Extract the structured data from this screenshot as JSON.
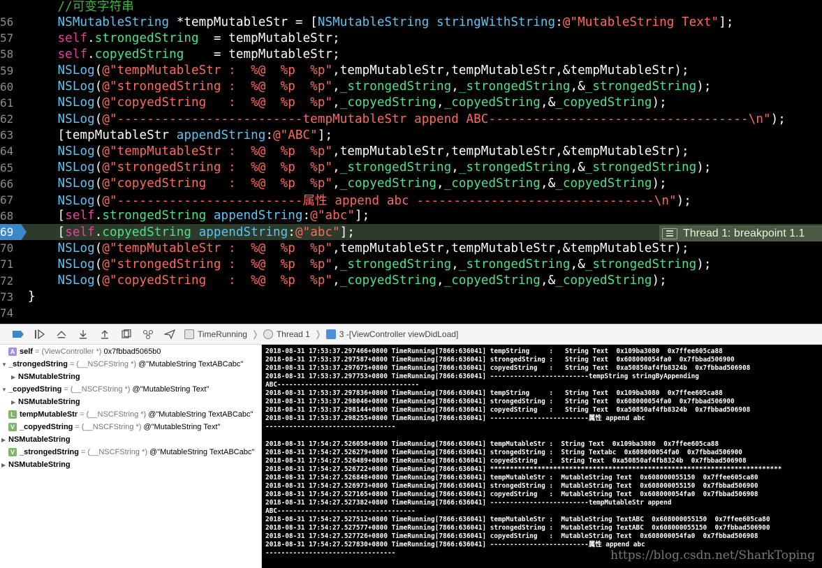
{
  "editor": {
    "lines": [
      {
        "num": "",
        "tokens": [
          {
            "c": "t-plain",
            "t": "    "
          },
          {
            "c": "t-comment",
            "t": "//可变字符串"
          }
        ]
      },
      {
        "num": "56",
        "tokens": [
          {
            "c": "t-plain",
            "t": "    "
          },
          {
            "c": "t-class",
            "t": "NSMutableString"
          },
          {
            "c": "t-plain",
            "t": " *tempMutableStr = ["
          },
          {
            "c": "t-class",
            "t": "NSMutableString"
          },
          {
            "c": "t-plain",
            "t": " "
          },
          {
            "c": "t-method",
            "t": "stringWithString"
          },
          {
            "c": "t-plain",
            "t": ":"
          },
          {
            "c": "t-str",
            "t": "@\"MutableString Text\""
          },
          {
            "c": "t-plain",
            "t": "];"
          }
        ]
      },
      {
        "num": "57",
        "tokens": [
          {
            "c": "t-plain",
            "t": "    "
          },
          {
            "c": "t-kw",
            "t": "self"
          },
          {
            "c": "t-plain",
            "t": "."
          },
          {
            "c": "t-prop",
            "t": "strongedString"
          },
          {
            "c": "t-plain",
            "t": "  = tempMutableStr;"
          }
        ]
      },
      {
        "num": "58",
        "tokens": [
          {
            "c": "t-plain",
            "t": "    "
          },
          {
            "c": "t-kw",
            "t": "self"
          },
          {
            "c": "t-plain",
            "t": "."
          },
          {
            "c": "t-prop",
            "t": "copyedString"
          },
          {
            "c": "t-plain",
            "t": "    = tempMutableStr;"
          }
        ]
      },
      {
        "num": "59",
        "tokens": [
          {
            "c": "t-plain",
            "t": "    "
          },
          {
            "c": "t-class",
            "t": "NSLog"
          },
          {
            "c": "t-plain",
            "t": "("
          },
          {
            "c": "t-str",
            "t": "@\"tempMutableStr :  %@  %p  %p\""
          },
          {
            "c": "t-plain",
            "t": ",tempMutableStr,tempMutableStr,&tempMutableStr);"
          }
        ]
      },
      {
        "num": "60",
        "tokens": [
          {
            "c": "t-plain",
            "t": "    "
          },
          {
            "c": "t-class",
            "t": "NSLog"
          },
          {
            "c": "t-plain",
            "t": "("
          },
          {
            "c": "t-str",
            "t": "@\"strongedString :  %@  %p  %p\""
          },
          {
            "c": "t-plain",
            "t": ","
          },
          {
            "c": "t-prop",
            "t": "_strongedString"
          },
          {
            "c": "t-plain",
            "t": ","
          },
          {
            "c": "t-prop",
            "t": "_strongedString"
          },
          {
            "c": "t-plain",
            "t": ",&"
          },
          {
            "c": "t-prop",
            "t": "_strongedString"
          },
          {
            "c": "t-plain",
            "t": ");"
          }
        ]
      },
      {
        "num": "61",
        "tokens": [
          {
            "c": "t-plain",
            "t": "    "
          },
          {
            "c": "t-class",
            "t": "NSLog"
          },
          {
            "c": "t-plain",
            "t": "("
          },
          {
            "c": "t-str",
            "t": "@\"copyedString   :  %@  %p  %p\""
          },
          {
            "c": "t-plain",
            "t": ","
          },
          {
            "c": "t-prop",
            "t": "_copyedString"
          },
          {
            "c": "t-plain",
            "t": ","
          },
          {
            "c": "t-prop",
            "t": "_copyedString"
          },
          {
            "c": "t-plain",
            "t": ",&"
          },
          {
            "c": "t-prop",
            "t": "_copyedString"
          },
          {
            "c": "t-plain",
            "t": ");"
          }
        ]
      },
      {
        "num": "62",
        "tokens": [
          {
            "c": "t-plain",
            "t": "    "
          },
          {
            "c": "t-class",
            "t": "NSLog"
          },
          {
            "c": "t-plain",
            "t": "("
          },
          {
            "c": "t-str",
            "t": "@\"-------------------------tempMutableStr append ABC-----------------------------------\\n\""
          },
          {
            "c": "t-plain",
            "t": ");"
          }
        ]
      },
      {
        "num": "63",
        "tokens": [
          {
            "c": "t-plain",
            "t": "    [tempMutableStr "
          },
          {
            "c": "t-method",
            "t": "appendString"
          },
          {
            "c": "t-plain",
            "t": ":"
          },
          {
            "c": "t-str",
            "t": "@\"ABC\""
          },
          {
            "c": "t-plain",
            "t": "];"
          }
        ]
      },
      {
        "num": "64",
        "tokens": [
          {
            "c": "t-plain",
            "t": "    "
          },
          {
            "c": "t-class",
            "t": "NSLog"
          },
          {
            "c": "t-plain",
            "t": "("
          },
          {
            "c": "t-str",
            "t": "@\"tempMutableStr :  %@  %p  %p\""
          },
          {
            "c": "t-plain",
            "t": ",tempMutableStr,tempMutableStr,&tempMutableStr);"
          }
        ]
      },
      {
        "num": "65",
        "tokens": [
          {
            "c": "t-plain",
            "t": "    "
          },
          {
            "c": "t-class",
            "t": "NSLog"
          },
          {
            "c": "t-plain",
            "t": "("
          },
          {
            "c": "t-str",
            "t": "@\"strongedString :  %@  %p  %p\""
          },
          {
            "c": "t-plain",
            "t": ","
          },
          {
            "c": "t-prop",
            "t": "_strongedString"
          },
          {
            "c": "t-plain",
            "t": ","
          },
          {
            "c": "t-prop",
            "t": "_strongedString"
          },
          {
            "c": "t-plain",
            "t": ",&"
          },
          {
            "c": "t-prop",
            "t": "_strongedString"
          },
          {
            "c": "t-plain",
            "t": ");"
          }
        ]
      },
      {
        "num": "66",
        "tokens": [
          {
            "c": "t-plain",
            "t": "    "
          },
          {
            "c": "t-class",
            "t": "NSLog"
          },
          {
            "c": "t-plain",
            "t": "("
          },
          {
            "c": "t-str",
            "t": "@\"copyedString   :  %@  %p  %p\""
          },
          {
            "c": "t-plain",
            "t": ","
          },
          {
            "c": "t-prop",
            "t": "_copyedString"
          },
          {
            "c": "t-plain",
            "t": ","
          },
          {
            "c": "t-prop",
            "t": "_copyedString"
          },
          {
            "c": "t-plain",
            "t": ",&"
          },
          {
            "c": "t-prop",
            "t": "_copyedString"
          },
          {
            "c": "t-plain",
            "t": ");"
          }
        ]
      },
      {
        "num": "67",
        "tokens": [
          {
            "c": "t-plain",
            "t": "    "
          },
          {
            "c": "t-class",
            "t": "NSLog"
          },
          {
            "c": "t-plain",
            "t": "("
          },
          {
            "c": "t-str",
            "t": "@\"-------------------------属性 append abc --------------------------------\\n\""
          },
          {
            "c": "t-plain",
            "t": ");"
          }
        ]
      },
      {
        "num": "68",
        "tokens": [
          {
            "c": "t-plain",
            "t": "    ["
          },
          {
            "c": "t-kw",
            "t": "self"
          },
          {
            "c": "t-plain",
            "t": "."
          },
          {
            "c": "t-prop",
            "t": "strongedString"
          },
          {
            "c": "t-plain",
            "t": " "
          },
          {
            "c": "t-method",
            "t": "appendString"
          },
          {
            "c": "t-plain",
            "t": ":"
          },
          {
            "c": "t-str",
            "t": "@\"abc\""
          },
          {
            "c": "t-plain",
            "t": "];"
          }
        ]
      },
      {
        "num": "69",
        "highlight": true,
        "tokens": [
          {
            "c": "t-plain",
            "t": "    ["
          },
          {
            "c": "t-kw",
            "t": "self"
          },
          {
            "c": "t-plain",
            "t": "."
          },
          {
            "c": "t-prop",
            "t": "copyedString"
          },
          {
            "c": "t-plain",
            "t": " "
          },
          {
            "c": "t-method",
            "t": "appendString"
          },
          {
            "c": "t-plain",
            "t": ":"
          },
          {
            "c": "t-str",
            "t": "@\"abc\""
          },
          {
            "c": "t-plain",
            "t": "];"
          }
        ]
      },
      {
        "num": "70",
        "tokens": [
          {
            "c": "t-plain",
            "t": "    "
          },
          {
            "c": "t-class",
            "t": "NSLog"
          },
          {
            "c": "t-plain",
            "t": "("
          },
          {
            "c": "t-str",
            "t": "@\"tempMutableStr :  %@  %p  %p\""
          },
          {
            "c": "t-plain",
            "t": ",tempMutableStr,tempMutableStr,&tempMutableStr);"
          }
        ]
      },
      {
        "num": "71",
        "tokens": [
          {
            "c": "t-plain",
            "t": "    "
          },
          {
            "c": "t-class",
            "t": "NSLog"
          },
          {
            "c": "t-plain",
            "t": "("
          },
          {
            "c": "t-str",
            "t": "@\"strongedString :  %@  %p  %p\""
          },
          {
            "c": "t-plain",
            "t": ","
          },
          {
            "c": "t-prop",
            "t": "_strongedString"
          },
          {
            "c": "t-plain",
            "t": ","
          },
          {
            "c": "t-prop",
            "t": "_strongedString"
          },
          {
            "c": "t-plain",
            "t": ",&"
          },
          {
            "c": "t-prop",
            "t": "_strongedString"
          },
          {
            "c": "t-plain",
            "t": ");"
          }
        ]
      },
      {
        "num": "72",
        "tokens": [
          {
            "c": "t-plain",
            "t": "    "
          },
          {
            "c": "t-class",
            "t": "NSLog"
          },
          {
            "c": "t-plain",
            "t": "("
          },
          {
            "c": "t-str",
            "t": "@\"copyedString   :  %@  %p  %p\""
          },
          {
            "c": "t-plain",
            "t": ","
          },
          {
            "c": "t-prop",
            "t": "_copyedString"
          },
          {
            "c": "t-plain",
            "t": ","
          },
          {
            "c": "t-prop",
            "t": "_copyedString"
          },
          {
            "c": "t-plain",
            "t": ",&"
          },
          {
            "c": "t-prop",
            "t": "_copyedString"
          },
          {
            "c": "t-plain",
            "t": ");"
          }
        ]
      },
      {
        "num": "73",
        "tokens": [
          {
            "c": "t-plain",
            "t": "}"
          }
        ]
      },
      {
        "num": "74",
        "tokens": []
      }
    ],
    "thread_badge": "Thread 1: breakpoint 1.1"
  },
  "debug_bar": {
    "breadcrumbs": [
      {
        "label": "TimeRunning",
        "icon": "app-icon"
      },
      {
        "label": "Thread 1",
        "icon": "thread-icon"
      },
      {
        "label": "3 -[ViewController viewDidLoad]",
        "icon": "frame-icon"
      }
    ]
  },
  "variables": [
    {
      "indent": 0,
      "disclosure": "",
      "badge": "A",
      "name": "self",
      "type": "= (ViewController *)",
      "value": "0x7fbbad5065b0"
    },
    {
      "indent": 0,
      "disclosure": "▼",
      "badge": "",
      "name": "_strongedString",
      "type": "= (__NSCFString *)",
      "value": "@\"MutableString TextABCabc\""
    },
    {
      "indent": 1,
      "disclosure": "▶",
      "badge": "",
      "name": "NSMutableString",
      "type": "",
      "value": ""
    },
    {
      "indent": 0,
      "disclosure": "▼",
      "badge": "",
      "name": "_copyedString",
      "type": "= (__NSCFString *)",
      "value": "@\"MutableString Text\""
    },
    {
      "indent": 1,
      "disclosure": "▶",
      "badge": "",
      "name": "NSMutableString",
      "type": "",
      "value": ""
    },
    {
      "indent": 0,
      "disclosure": "",
      "badge": "L",
      "name": "tempMutableStr",
      "type": "= (__NSCFString *)",
      "value": "@\"MutableString TextABCabc\""
    },
    {
      "indent": 0,
      "disclosure": "",
      "badge": "V",
      "name": "_copyedString",
      "type": "= (__NSCFString *)",
      "value": "@\"MutableString Text\""
    },
    {
      "indent": 0,
      "disclosure": "▶",
      "badge": "",
      "name": "NSMutableString",
      "type": "",
      "value": ""
    },
    {
      "indent": 0,
      "disclosure": "",
      "badge": "V",
      "name": "_strongedString",
      "type": "= (__NSCFString *)",
      "value": "@\"MutableString TextABCabc\""
    },
    {
      "indent": 0,
      "disclosure": "▶",
      "badge": "",
      "name": "NSMutableString",
      "type": "",
      "value": ""
    }
  ],
  "console": {
    "lines": [
      "2018-08-31 17:53:37.297466+0800 TimeRunning[7866:636041] tempString     :   String Text  0x109ba3080  0x7ffee605ca88",
      "2018-08-31 17:53:37.297587+0800 TimeRunning[7866:636041] strongedString :   String Text  0x608000054fa0  0x7fbbad506900",
      "2018-08-31 17:53:37.297675+0800 TimeRunning[7866:636041] copyedString   :   String Text  0xa50850af4fb8324b  0x7fbbad506908",
      "2018-08-31 17:53:37.297753+0800 TimeRunning[7866:636041] -------------------------tempString stringByAppending",
      "ABC------------------------------------",
      "2018-08-31 17:53:37.297836+0800 TimeRunning[7866:636041] tempString     :   String Text  0x109ba3080  0x7ffee605ca88",
      "2018-08-31 17:53:37.298046+0800 TimeRunning[7866:636041] strongedString :   String Text  0x608000054fa0  0x7fbbad506900",
      "2018-08-31 17:53:37.298144+0800 TimeRunning[7866:636041] copyedString   :   String Text  0xa50850af4fb8324b  0x7fbbad506908",
      "2018-08-31 17:53:37.298255+0800 TimeRunning[7866:636041] -------------------------属性 append abc",
      "---------------------------------",
      "",
      "2018-08-31 17:54:27.526058+0800 TimeRunning[7866:636041] tempMutableStr :  String Text  0x109ba3080  0x7ffee605ca88",
      "2018-08-31 17:54:27.526279+0800 TimeRunning[7866:636041] strongedString :  String Textabc  0x608000054fa0  0x7fbbad506900",
      "2018-08-31 17:54:27.526489+0800 TimeRunning[7866:636041] copyedString   :  String Text  0xa50850af4fb8324b  0x7fbbad506908",
      "2018-08-31 17:54:27.526722+0800 TimeRunning[7866:636041] **************************************************************************",
      "2018-08-31 17:54:27.526848+0800 TimeRunning[7866:636041] tempMutableStr :  MutableString Text  0x608000055150  0x7ffee605ca80",
      "2018-08-31 17:54:27.526973+0800 TimeRunning[7866:636041] strongedString :  MutableString Text  0x608000055150  0x7fbbad506900",
      "2018-08-31 17:54:27.527165+0800 TimeRunning[7866:636041] copyedString   :  MutableString Text  0x608000054fa0  0x7fbbad506908",
      "2018-08-31 17:54:27.527382+0800 TimeRunning[7866:636041] -------------------------tempMutableStr append",
      "ABC-----------------------------------",
      "2018-08-31 17:54:27.527512+0800 TimeRunning[7866:636041] tempMutableStr :  MutableString TextABC  0x608000055150  0x7ffee605ca80",
      "2018-08-31 17:54:27.527577+0800 TimeRunning[7866:636041] strongedString :  MutableString TextABC  0x608000055150  0x7fbbad506900",
      "2018-08-31 17:54:27.527726+0800 TimeRunning[7866:636041] copyedString   :  MutableString Text  0x608000054fa0  0x7fbbad506908",
      "2018-08-31 17:54:27.527830+0800 TimeRunning[7866:636041] -------------------------属性 append abc",
      "---------------------------------"
    ],
    "watermark": "https://blog.csdn.net/SharkToping"
  },
  "colors": {
    "editor_bg": "#000000",
    "highlight_line": "#2d3b2b",
    "breakpoint": "#3a87c9",
    "keyword": "#ed3e9e",
    "class": "#5dc4f2",
    "property": "#4ee08a",
    "string": "#fc6a5d",
    "comment": "#41b645"
  }
}
